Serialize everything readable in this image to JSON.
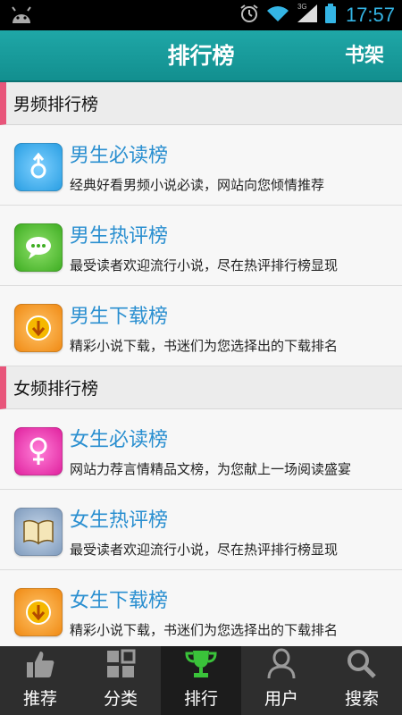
{
  "status_bar": {
    "time": "17:57",
    "network": "3G"
  },
  "header": {
    "title": "排行榜",
    "shelf_label": "书架"
  },
  "sections": [
    {
      "title": "男频排行榜",
      "items": [
        {
          "name": "男生必读榜",
          "desc": "经典好看男频小说必读，网站向您倾情推荐",
          "icon": "male-symbol-icon",
          "color": "#3fb0ec"
        },
        {
          "name": "男生热评榜",
          "desc": "最受读者欢迎流行小说，尽在热评排行榜显现",
          "icon": "chat-bubble-icon",
          "color": "#55c236"
        },
        {
          "name": "男生下载榜",
          "desc": "精彩小说下载，书迷们为您选择出的下载排名",
          "icon": "download-icon",
          "color": "#f59a2a"
        }
      ]
    },
    {
      "title": "女频排行榜",
      "items": [
        {
          "name": "女生必读榜",
          "desc": "网站力荐言情精品文榜，为您献上一场阅读盛宴",
          "icon": "female-symbol-icon",
          "color": "#ee3fb4"
        },
        {
          "name": "女生热评榜",
          "desc": "最受读者欢迎流行小说，尽在热评排行榜显现",
          "icon": "open-book-icon",
          "color": "#8fa8c4"
        },
        {
          "name": "女生下载榜",
          "desc": "精彩小说下载，书迷们为您选择出的下载排名",
          "icon": "download-icon",
          "color": "#f59a2a"
        }
      ]
    }
  ],
  "bottom_nav": [
    {
      "label": "推荐",
      "icon": "thumbs-up-icon",
      "active": false
    },
    {
      "label": "分类",
      "icon": "grid-icon",
      "active": false
    },
    {
      "label": "排行",
      "icon": "trophy-icon",
      "active": true
    },
    {
      "label": "用户",
      "icon": "user-icon",
      "active": false
    },
    {
      "label": "搜索",
      "icon": "search-icon",
      "active": false
    }
  ]
}
